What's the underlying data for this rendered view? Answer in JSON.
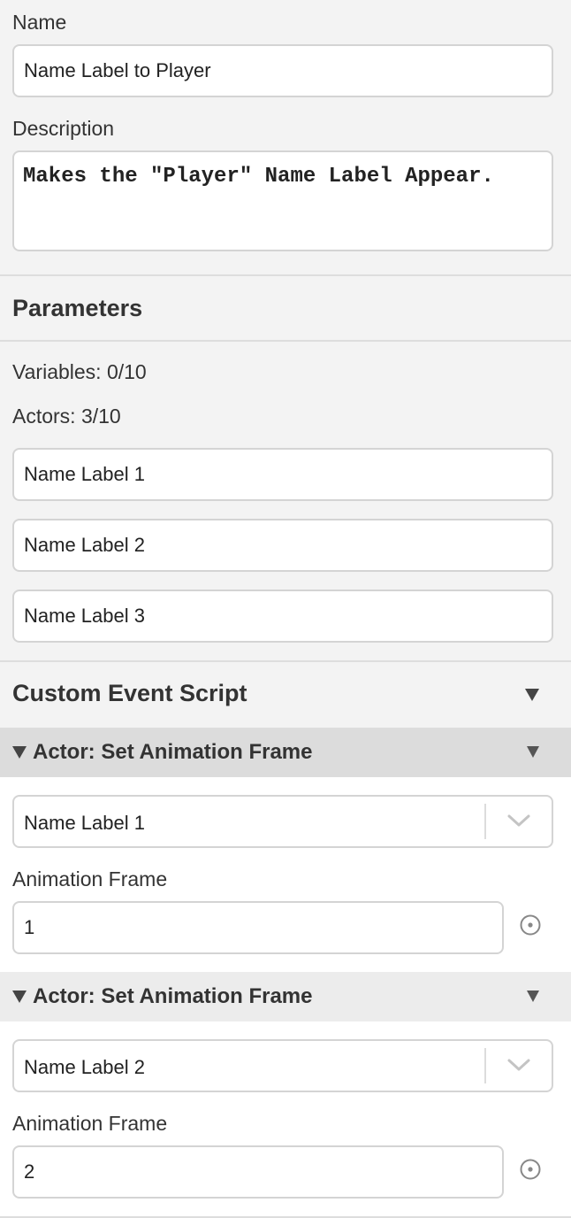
{
  "name": {
    "label": "Name",
    "value": "Name Label to Player"
  },
  "description": {
    "label": "Description",
    "value": "Makes the \"Player\" Name Label Appear."
  },
  "parameters": {
    "title": "Parameters",
    "variables": "Variables: 0/10",
    "actors_count": "Actors: 3/10",
    "actors": [
      "Name Label 1",
      "Name Label 2",
      "Name Label 3"
    ]
  },
  "script": {
    "title": "Custom Event Script",
    "events": [
      {
        "title": "Actor: Set Animation Frame",
        "actor": "Name Label 1",
        "frame_label": "Animation Frame",
        "frame_value": "1"
      },
      {
        "title": "Actor: Set Animation Frame",
        "actor": "Name Label 2",
        "frame_label": "Animation Frame",
        "frame_value": "2"
      }
    ]
  },
  "icons": {
    "section_toggle": "triangle-down-icon",
    "event_collapse": "triangle-down-icon",
    "event_menu": "triangle-down-icon",
    "dropdown": "chevron-down-icon",
    "variable_toggle": "target-icon"
  },
  "colors": {
    "panel_bg": "#f3f3f3",
    "field_bg": "#ffffff",
    "field_border": "#d4d4d4",
    "event_header_active": "#dcdcdc",
    "event_header": "#ececec"
  }
}
